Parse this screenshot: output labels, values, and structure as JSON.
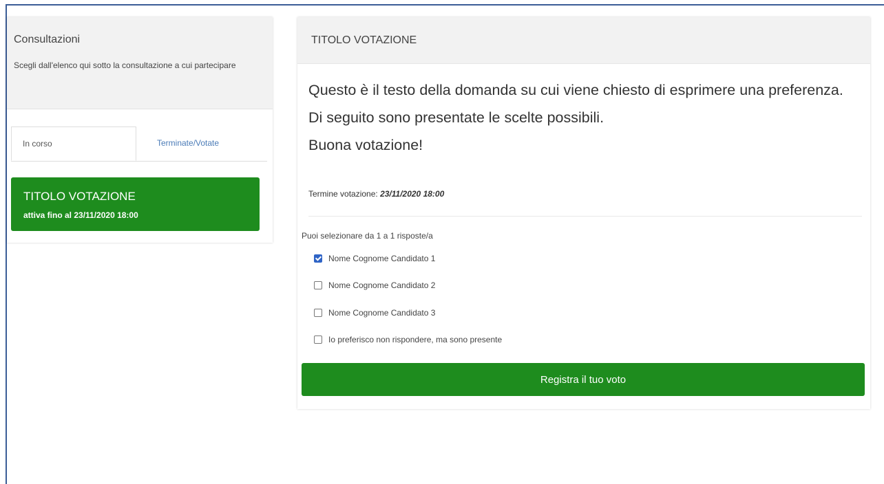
{
  "sidebar": {
    "title": "Consultazioni",
    "description": "Scegli dall'elenco qui sotto la consultazione a cui partecipare",
    "tabs": [
      {
        "label": "In corso",
        "active": true
      },
      {
        "label": "Terminate/Votate",
        "active": false
      }
    ],
    "vote_item": {
      "title": "TITOLO VOTAZIONE",
      "subtitle": "attiva fino al 23/11/2020 18:00"
    }
  },
  "main": {
    "header": "TITOLO VOTAZIONE",
    "question_line1": "Questo è il testo della domanda su cui viene chiesto di esprimere una preferenza.",
    "question_line2": "Di seguito sono presentate le scelte possibili.",
    "question_line3": "Buona votazione!",
    "deadline_label": "Termine votazione:",
    "deadline_value": "23/11/2020 18:00",
    "instructions": "Puoi selezionare da 1 a 1 risposte/a",
    "options": [
      {
        "label": "Nome Cognome Candidato 1",
        "checked": true
      },
      {
        "label": "Nome Cognome Candidato 2",
        "checked": false
      },
      {
        "label": "Nome Cognome Candidato 3",
        "checked": false
      },
      {
        "label": "Io preferisco non rispondere, ma sono presente",
        "checked": false
      }
    ],
    "submit_label": "Registra il tuo voto"
  },
  "colors": {
    "accent_green": "#1e8c1e",
    "link_blue": "#4a7bb7",
    "checkbox_blue": "#2f64c6"
  }
}
